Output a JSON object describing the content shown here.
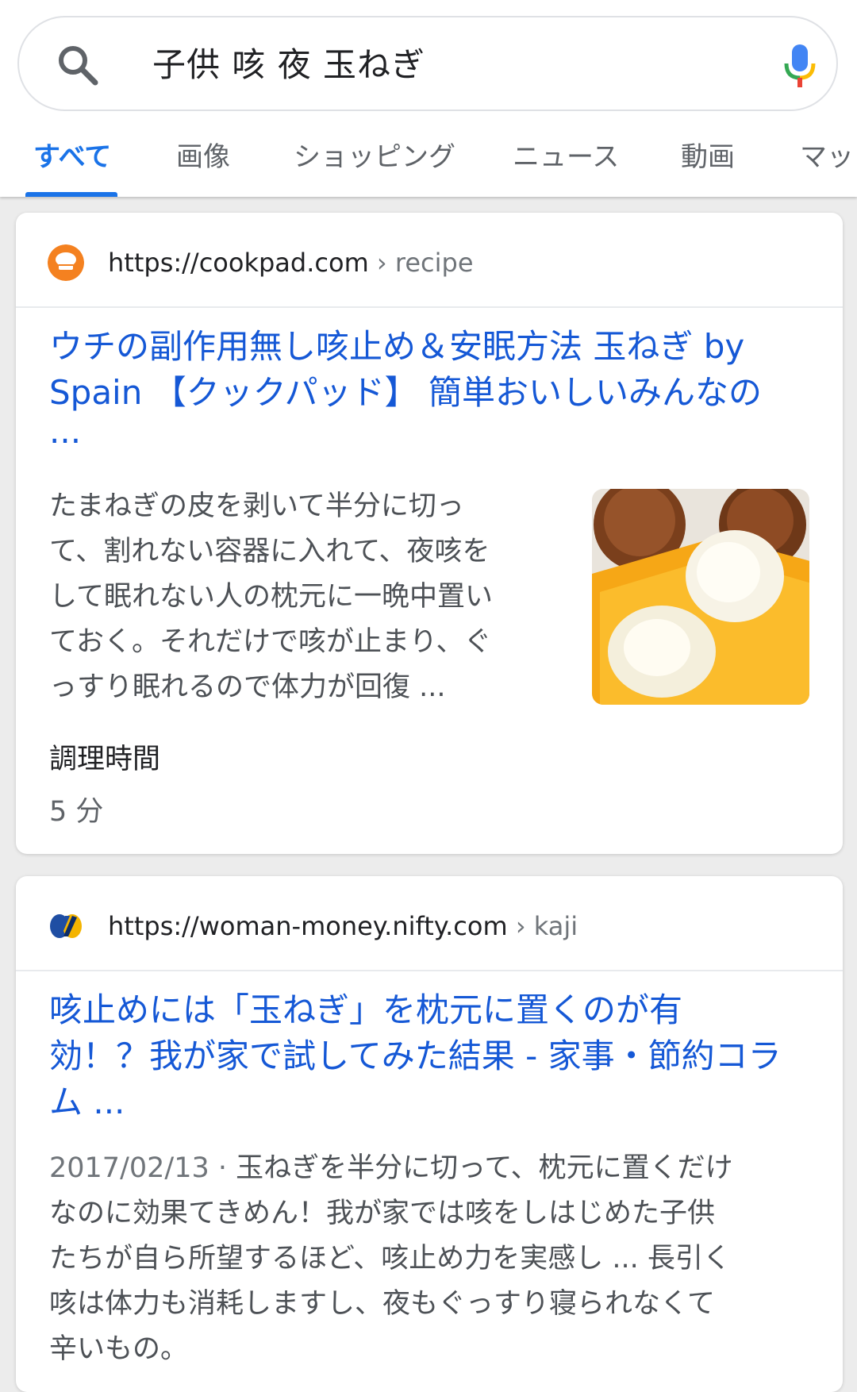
{
  "search": {
    "query": "子供 咳 夜 玉ねぎ"
  },
  "tabs": [
    {
      "label": "すべて",
      "active": true
    },
    {
      "label": "画像"
    },
    {
      "label": "ショッピング"
    },
    {
      "label": "ニュース"
    },
    {
      "label": "動画"
    },
    {
      "label": "マッ"
    }
  ],
  "results": [
    {
      "url": "https://cookpad.com",
      "crumb": "› recipe",
      "title_lines": [
        "ウチの副作用無し咳止め＆安眠方法 玉ねぎ by",
        "Spain 【クックパッド】 簡単おいしいみんなの",
        "..."
      ],
      "snippet_lines": [
        "たまねぎの皮を剥いて半分に切っ",
        "て、割れない容器に入れて、夜咳を",
        "して眠れない人の枕元に一晩中置い",
        "ておく。それだけで咳が止まり、ぐ",
        "っすり眠れるので体力が回復 ..."
      ],
      "meta_label": "調理時間",
      "meta_value": "5 分",
      "thumbnail": "onion-photo"
    },
    {
      "url": "https://woman-money.nifty.com",
      "crumb": "› kaji",
      "title_lines": [
        "咳止めには「玉ねぎ」を枕元に置くのが有",
        "効！？我が家で試してみた結果 - 家事・節約コラ",
        "ム ..."
      ],
      "date": "2017/02/13 · ",
      "snippet_first": "玉ねぎを半分に切って、枕元に置くだけ",
      "snippet_lines": [
        "なのに効果てきめん！我が家では咳をしはじめた子供",
        "たちが自ら所望するほど、咳止め力を実感し ... 長引く",
        "咳は体力も消耗しますし、夜もぐっすり寝られなくて",
        "辛いもの。"
      ]
    }
  ],
  "colors": {
    "link": "#1558d6",
    "active_tab": "#1a73e8",
    "background": "#ececec"
  }
}
